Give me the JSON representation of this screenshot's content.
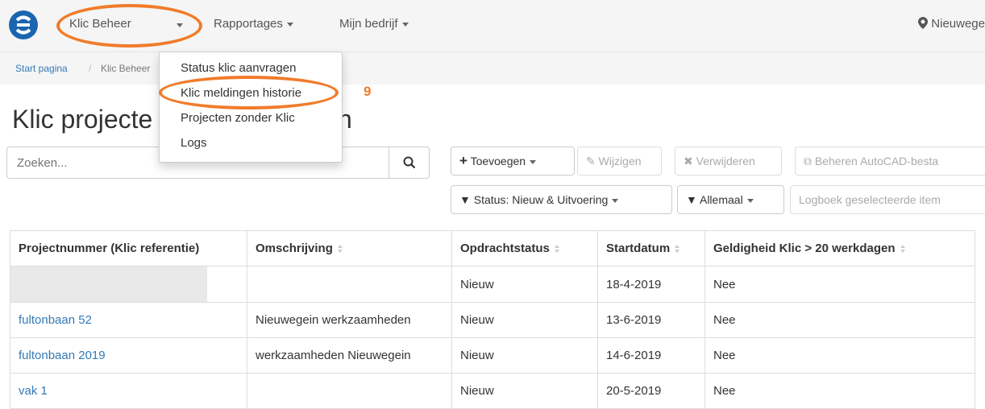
{
  "nav": {
    "items": [
      {
        "label": "Klic Beheer"
      },
      {
        "label": "Rapportages"
      },
      {
        "label": "Mijn bedrijf"
      }
    ],
    "location": "Nieuwege"
  },
  "breadcrumb": {
    "home": "Start pagina",
    "separator": "/",
    "current": "Klic Beheer"
  },
  "dropdown": {
    "items": [
      "Status klic aanvragen",
      "Klic meldingen historie",
      "Projecten zonder Klic",
      "Logs"
    ]
  },
  "annotation": {
    "marker": "9",
    "color": "#f07c2b"
  },
  "page": {
    "title_left": "Klic projecte",
    "title_right": "n"
  },
  "search": {
    "placeholder": "Zoeken..."
  },
  "toolbar": {
    "add": "Toevoegen",
    "edit": "Wijzigen",
    "delete": "Verwijderen",
    "autocad": "Beheren AutoCAD-besta",
    "status_filter": "Status: Nieuw & Uitvoering",
    "all_filter": "Allemaal",
    "logbook": "Logboek geselecteerde item"
  },
  "table": {
    "headers": [
      "Projectnummer (Klic referentie)",
      "Omschrijving",
      "Opdrachtstatus",
      "Startdatum",
      "Geldigheid Klic > 20 werkdagen"
    ],
    "rows": [
      [
        "",
        "",
        "Nieuw",
        "18-4-2019",
        "Nee"
      ],
      [
        "fultonbaan 52",
        "Nieuwegein werkzaamheden",
        "Nieuw",
        "13-6-2019",
        "Nee"
      ],
      [
        "fultonbaan 2019",
        "werkzaamheden Nieuwegein",
        "Nieuw",
        "14-6-2019",
        "Nee"
      ],
      [
        "vak 1",
        "",
        "Nieuw",
        "20-5-2019",
        "Nee"
      ]
    ]
  }
}
